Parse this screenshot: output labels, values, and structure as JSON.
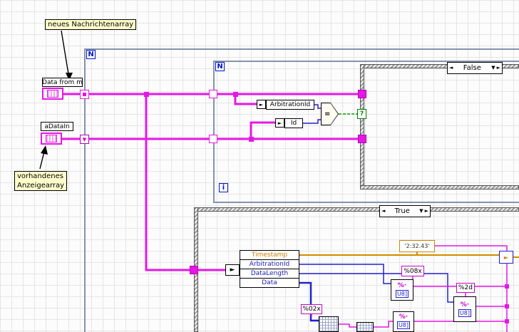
{
  "annotations": {
    "new_messages_label": "neues Nachrichtenarray",
    "existing_array_label_line1": "vorhandenes",
    "existing_array_label_line2": "Anzeigearray"
  },
  "terminals": {
    "data_from": "Data from m",
    "adata_in": "aDataIn"
  },
  "outer_loop": {
    "count": "N"
  },
  "inner_loop": {
    "count": "N",
    "iteration": "i"
  },
  "case_false": {
    "selected": "False",
    "prev_glyph": "◄",
    "next_glyph": "►",
    "dropdown_glyph": "▼"
  },
  "case_true": {
    "selected": "True",
    "prev_glyph": "◄",
    "next_glyph": "►",
    "dropdown_glyph": "▼"
  },
  "compare": {
    "arrow_glyph": "►",
    "arbitration_id": "ArbitrationId",
    "id": "Id",
    "equals_glyph": "=",
    "selector_glyph": "?"
  },
  "shift_register_glyph": "▼",
  "unbundle": {
    "arrow_glyph": "►",
    "rows": [
      "Timestamp",
      "ArbitrationId",
      "DataLength",
      "Data"
    ]
  },
  "constants": {
    "time_string": "'2:32.43'",
    "format_hex8": "%08x",
    "format_dec2": "%2d",
    "format_hex2": "%02x"
  },
  "format_node": {
    "percent_glyph": "%·",
    "u8_glyph": "U8]"
  },
  "misc": {
    "append_glyph": "►"
  },
  "colors": {
    "cluster_wire": "#e617e6",
    "numeric_wire": "#2121cc",
    "timestamp_wire": "#d48a00",
    "boolean_wire": "#00a000",
    "free_label_bg": "#ffffcc",
    "loop_border": "#8494ad",
    "case_border_gray": "#9a9a9a"
  }
}
